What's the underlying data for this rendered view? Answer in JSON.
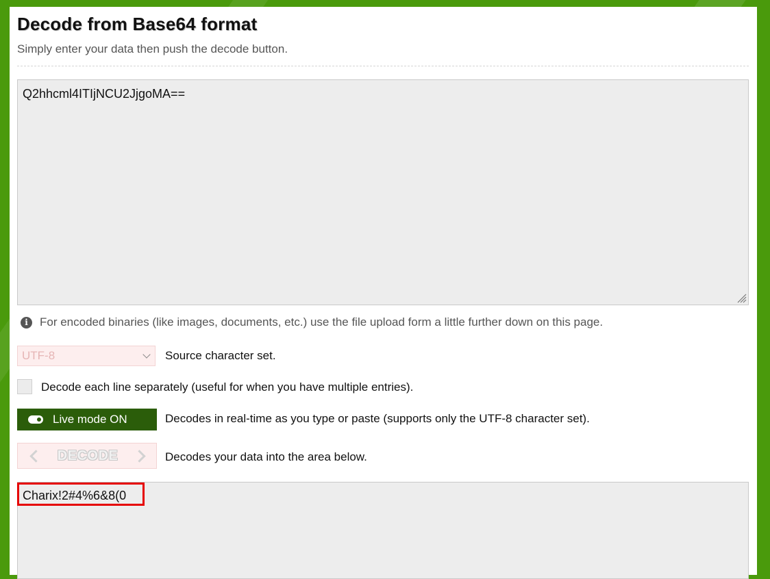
{
  "header": {
    "title": "Decode from Base64 format",
    "subtitle": "Simply enter your data then push the decode button."
  },
  "input": {
    "value": "Q2hhcml4ITIjNCU2JjgoMA=="
  },
  "info": {
    "text": "For encoded binaries (like images, documents, etc.) use the file upload form a little further down on this page."
  },
  "charset": {
    "selected": "UTF-8",
    "label": "Source character set."
  },
  "line_option": {
    "label": "Decode each line separately (useful for when you have multiple entries)."
  },
  "live_mode": {
    "button_label": "Live mode ON",
    "description": "Decodes in real-time as you type or paste (supports only the UTF-8 character set)."
  },
  "decode": {
    "button_label": "DECODE",
    "description": "Decodes your data into the area below."
  },
  "output": {
    "value": "Charix!2#4%6&8(0"
  },
  "colors": {
    "page_background": "#4a9a0c",
    "live_button": "#2b5d0a",
    "highlight": "#e60000"
  }
}
